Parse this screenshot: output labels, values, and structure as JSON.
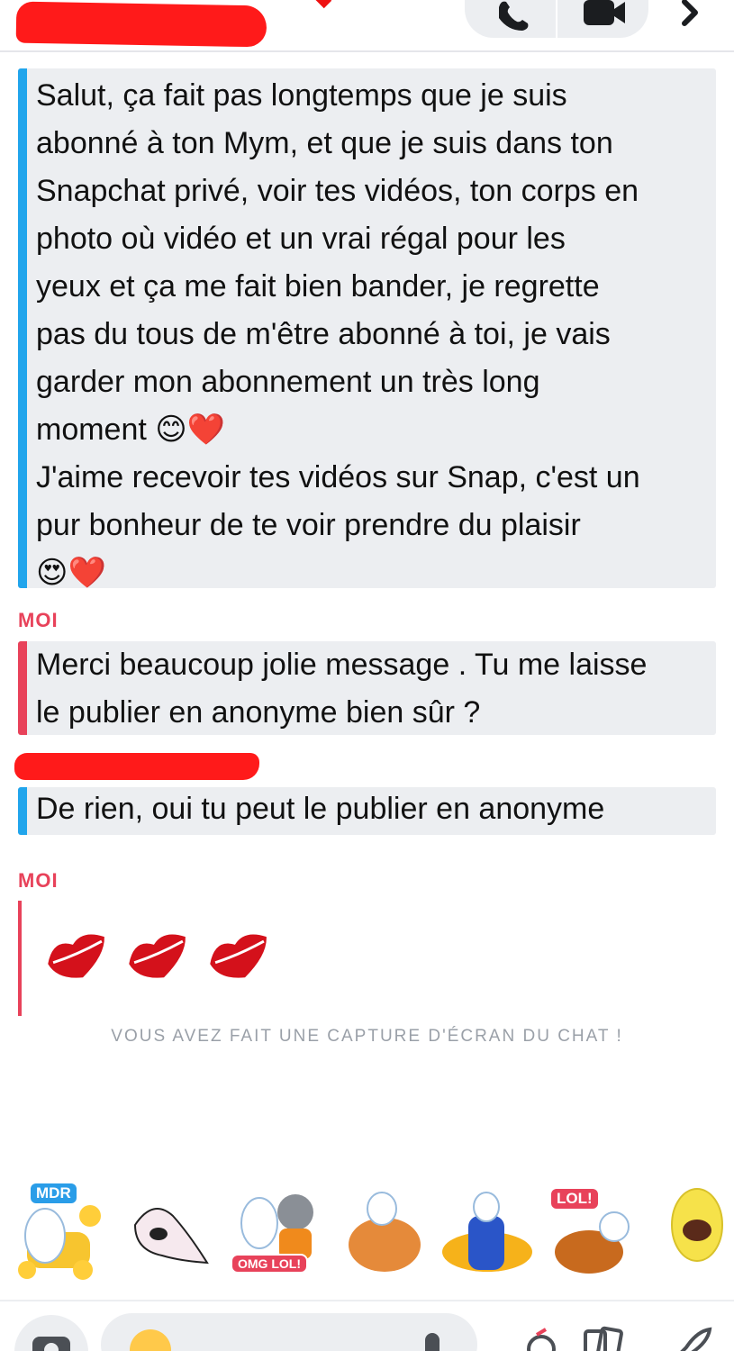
{
  "header": {
    "contact_name": "",
    "phone_icon": "phone-icon",
    "video_icon": "video-camera-icon",
    "more_icon": "chevron-right-icon"
  },
  "messages": [
    {
      "sender": "",
      "color": "#21a5ec",
      "text": "Salut, ça fait pas longtemps que je suis\nabonné à ton Mym, et que je suis dans ton\nSnapchat privé, voir tes vidéos, ton corps en\nphoto où vidéo et un vrai régal pour les\nyeux et ça me fait bien bander, je regrette\npas du tous de m'être abonné à toi, je vais\ngarder mon abonnement un très long\nmoment 😊❤️\nJ'aime recevoir tes vidéos sur Snap, c'est un\npur bonheur de te voir prendre du plaisir\n😍❤️"
    },
    {
      "sender": "MOI",
      "color": "#e8425a",
      "text": "Merci beaucoup jolie message . Tu me laisse\nle publier en anonyme bien sûr ?"
    },
    {
      "sender": "",
      "color": "#21a5ec",
      "text": "De rien, oui tu peut le publier en anonyme"
    },
    {
      "sender": "MOI",
      "color": "#e8425a",
      "emoji": "💋💋💋"
    }
  ],
  "notice": "VOUS AVEZ FAIT UNE CAPTURE D'ÉCRAN DU CHAT !",
  "stickers": [
    {
      "name": "mdr-sticker",
      "label": "MDR"
    },
    {
      "name": "laughing-ghost-sticker",
      "label": ""
    },
    {
      "name": "omg-lol-cat-sticker",
      "label": "OMG LOL!"
    },
    {
      "name": "fat-cat-sticker",
      "label": ""
    },
    {
      "name": "explosion-sticker",
      "label": ""
    },
    {
      "name": "lol-chicken-sticker",
      "label": "LOL!"
    },
    {
      "name": "lemon-sticker",
      "label": ""
    }
  ],
  "composer": {
    "camera_icon": "camera-icon",
    "emoji_icon": "smiley-icon",
    "mic_icon": "microphone-icon",
    "sticker_icon": "sticker-icon",
    "memories_icon": "cards-icon",
    "rocket_icon": "rocket-icon"
  },
  "colors": {
    "accent_blue": "#21a5ec",
    "accent_red": "#e8425a",
    "bubble_bg": "#eceef1",
    "notice": "#9aa0a8"
  }
}
